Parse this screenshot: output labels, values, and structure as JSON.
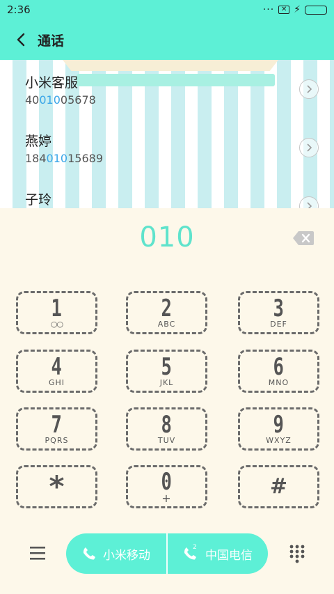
{
  "status_bar": {
    "time": "2:36",
    "more": "···",
    "notification": "✕"
  },
  "app_bar": {
    "title": "通话"
  },
  "results": [
    {
      "name": "小米客服",
      "number_prefix": "40",
      "number_match": "010",
      "number_suffix": "05678"
    },
    {
      "name": "燕婷",
      "number_prefix": "184",
      "number_match": "010",
      "number_suffix": "15689"
    },
    {
      "name": "子玲"
    }
  ],
  "dialer": {
    "input": "010"
  },
  "keypad": {
    "k1": {
      "digit": "1",
      "sub": "○○"
    },
    "k2": {
      "digit": "2",
      "sub": "ABC"
    },
    "k3": {
      "digit": "3",
      "sub": "DEF"
    },
    "k4": {
      "digit": "4",
      "sub": "GHI"
    },
    "k5": {
      "digit": "5",
      "sub": "JKL"
    },
    "k6": {
      "digit": "6",
      "sub": "MNO"
    },
    "k7": {
      "digit": "7",
      "sub": "PQRS"
    },
    "k8": {
      "digit": "8",
      "sub": "TUV"
    },
    "k9": {
      "digit": "9",
      "sub": "WXYZ"
    },
    "kstar": {
      "digit": "*"
    },
    "k0": {
      "digit": "0",
      "sub": "+"
    },
    "khash": {
      "digit": "#"
    }
  },
  "call_buttons": {
    "sim1_label": "小米移动",
    "sim2_label": "中国电信",
    "sim2_index": "2"
  },
  "colors": {
    "accent": "#5df0d6",
    "digits": "#5fe3cc",
    "match_highlight": "#3aa6e8",
    "background": "#fdf8ea"
  }
}
